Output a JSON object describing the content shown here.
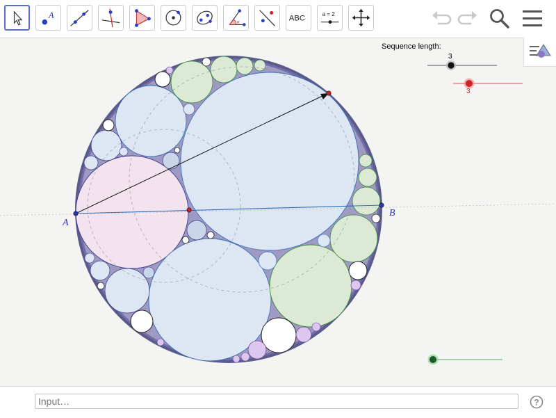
{
  "toolbar": {
    "tools": [
      {
        "name": "move-tool",
        "icon": "arrow-cursor-icon"
      },
      {
        "name": "point-tool",
        "icon": "point-icon",
        "label": "A"
      },
      {
        "name": "line-tool",
        "icon": "line-icon"
      },
      {
        "name": "perpendicular-tool",
        "icon": "perpendicular-line-icon"
      },
      {
        "name": "polygon-tool",
        "icon": "polygon-icon"
      },
      {
        "name": "circle-tool",
        "icon": "circle-center-icon"
      },
      {
        "name": "conic-tool",
        "icon": "ellipse-icon"
      },
      {
        "name": "angle-tool",
        "icon": "angle-icon"
      },
      {
        "name": "reflect-tool",
        "icon": "reflect-icon"
      },
      {
        "name": "text-tool",
        "icon": "text-icon",
        "label": "ABC"
      },
      {
        "name": "slider-tool",
        "icon": "slider-icon",
        "label": "a = 2"
      },
      {
        "name": "move-graphics-tool",
        "icon": "move-graphics-icon"
      }
    ],
    "right": [
      "undo-icon",
      "redo-icon",
      "search-icon",
      "menu-icon"
    ]
  },
  "graphics": {
    "slider_label": "Sequence length:",
    "slider_value": "3",
    "red_slider_value": "3",
    "point_a_label": "A",
    "point_b_label": "B",
    "colors": {
      "outer": "#3f3f3f",
      "blue_fill": "#dde6f3",
      "pink_fill": "#f3e3ef",
      "green_fill": "#dbe9d5",
      "purple_fill": "#dcc8ee",
      "white_fill": "#ffffff",
      "line": "#2e6fb5",
      "red_point": "#cc2222",
      "green_point": "#2e8b3a"
    }
  },
  "input": {
    "placeholder": "Input…"
  }
}
